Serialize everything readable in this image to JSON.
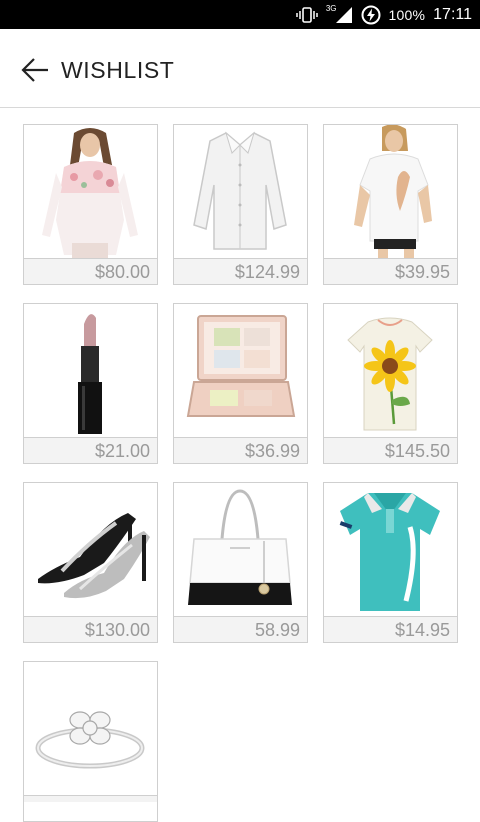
{
  "status_bar": {
    "network_label": "3G",
    "battery_percent": "100%",
    "time": "17:11",
    "icons": [
      "vibrate-icon",
      "signal-icon",
      "battery-charging-icon"
    ]
  },
  "header": {
    "title": "WISHLIST",
    "back_icon": "arrow-left-icon"
  },
  "items": [
    {
      "product": "floral-blouse",
      "price": "$80.00"
    },
    {
      "product": "white-shirt",
      "price": "$124.99"
    },
    {
      "product": "white-tee",
      "price": "$39.95"
    },
    {
      "product": "lipstick",
      "price": "$21.00"
    },
    {
      "product": "makeup-palette",
      "price": "$36.99"
    },
    {
      "product": "sunflower-tee",
      "price": "$145.50"
    },
    {
      "product": "strappy-heels",
      "price": "$130.00"
    },
    {
      "product": "handbag",
      "price": "58.99"
    },
    {
      "product": "polo-shirt",
      "price": "$14.95"
    },
    {
      "product": "diamond-ring",
      "price": ""
    }
  ],
  "colors": {
    "status_bar_bg": "#000000",
    "price_bg": "#f3f3f3",
    "price_text": "#9a9a9a",
    "border": "#cfcfcf"
  }
}
